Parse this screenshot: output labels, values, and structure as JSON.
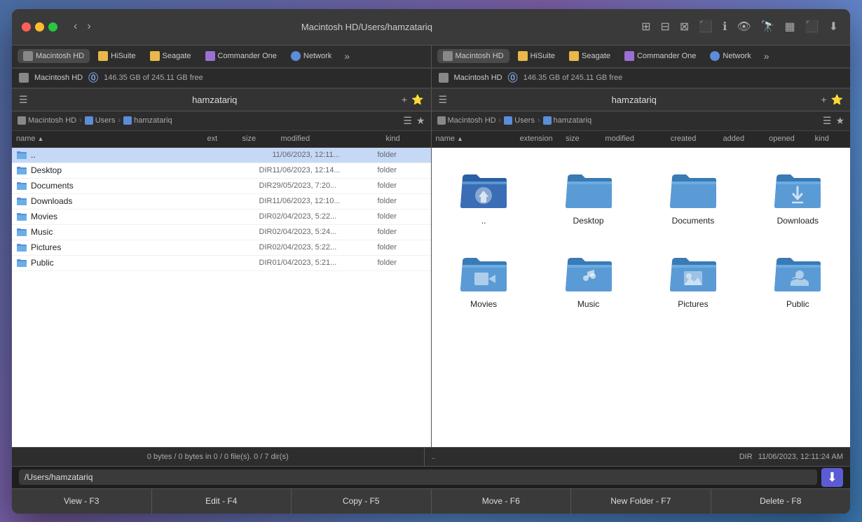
{
  "window": {
    "title": "Macintosh HD/Users/hamzatariq",
    "traffic_lights": [
      "close",
      "minimize",
      "maximize"
    ]
  },
  "tabs": [
    {
      "id": "macintosh-hd",
      "label": "Macintosh HD",
      "type": "drive"
    },
    {
      "id": "hisuite",
      "label": "HiSuite",
      "type": "app"
    },
    {
      "id": "seagate",
      "label": "Seagate",
      "type": "drive"
    },
    {
      "id": "commander-one",
      "label": "Commander One",
      "type": "app"
    },
    {
      "id": "network",
      "label": "Network",
      "type": "network"
    }
  ],
  "storage": {
    "icon": "drive",
    "label": "Macintosh HD",
    "free_text": "146.35 GB of 245.11 GB free"
  },
  "left_panel": {
    "title": "hamzatariq",
    "breadcrumb": [
      "Macintosh HD",
      "Users",
      "hamzatariq"
    ],
    "columns": {
      "name": "name",
      "ext": "ext",
      "size": "size",
      "modified": "modified",
      "kind": "kind"
    },
    "files": [
      {
        "name": "..",
        "ext": "",
        "size": "",
        "modified": "11/06/2023, 12:11...",
        "kind": "folder",
        "type": "dir"
      },
      {
        "name": "Desktop",
        "ext": "",
        "size": "DIR",
        "modified": "11/06/2023, 12:14...",
        "kind": "folder",
        "type": "dir"
      },
      {
        "name": "Documents",
        "ext": "",
        "size": "DIR",
        "modified": "29/05/2023, 7:20...",
        "kind": "folder",
        "type": "dir"
      },
      {
        "name": "Downloads",
        "ext": "",
        "size": "DIR",
        "modified": "11/06/2023, 12:10...",
        "kind": "folder",
        "type": "dir"
      },
      {
        "name": "Movies",
        "ext": "",
        "size": "DIR",
        "modified": "02/04/2023, 5:22...",
        "kind": "folder",
        "type": "dir"
      },
      {
        "name": "Music",
        "ext": "",
        "size": "DIR",
        "modified": "02/04/2023, 5:24...",
        "kind": "folder",
        "type": "dir"
      },
      {
        "name": "Pictures",
        "ext": "",
        "size": "DIR",
        "modified": "02/04/2023, 5:22...",
        "kind": "folder",
        "type": "dir"
      },
      {
        "name": "Public",
        "ext": "",
        "size": "DIR",
        "modified": "01/04/2023, 5:21...",
        "kind": "folder",
        "type": "dir"
      }
    ],
    "status": "0 bytes / 0 bytes in 0 / 0 file(s). 0 / 7 dir(s)"
  },
  "right_panel": {
    "title": "hamzatariq",
    "breadcrumb": [
      "Macintosh HD",
      "Users",
      "hamzatariq"
    ],
    "columns": {
      "name": "name",
      "extension": "extension",
      "size": "size",
      "modified": "modified",
      "created": "created",
      "added": "added",
      "opened": "opened",
      "kind": "kind"
    },
    "icons": [
      {
        "name": "..",
        "type": "home",
        "icon_color": "#3a6db5"
      },
      {
        "name": "Desktop",
        "type": "folder",
        "icon_color": "#5b9bd5"
      },
      {
        "name": "Documents",
        "type": "folder",
        "icon_color": "#5b9bd5"
      },
      {
        "name": "Downloads",
        "type": "folder_download",
        "icon_color": "#5b9bd5"
      },
      {
        "name": "Movies",
        "type": "folder_video",
        "icon_color": "#5b9bd5"
      },
      {
        "name": "Music",
        "type": "folder_music",
        "icon_color": "#5b9bd5"
      },
      {
        "name": "Pictures",
        "type": "folder_pictures",
        "icon_color": "#5b9bd5"
      },
      {
        "name": "Public",
        "type": "folder_public",
        "icon_color": "#5b9bd5"
      }
    ],
    "status_left": "..",
    "status_dir": "DIR",
    "status_modified": "11/06/2023, 12:11:24 AM"
  },
  "path_bar": {
    "value": "/Users/hamzatariq"
  },
  "bottom_toolbar": {
    "buttons": [
      {
        "label": "View - F3",
        "key": "F3"
      },
      {
        "label": "Edit - F4",
        "key": "F4"
      },
      {
        "label": "Copy - F5",
        "key": "F5"
      },
      {
        "label": "Move - F6",
        "key": "F6"
      },
      {
        "label": "New Folder - F7",
        "key": "F7"
      },
      {
        "label": "Delete - F8",
        "key": "F8"
      }
    ]
  }
}
